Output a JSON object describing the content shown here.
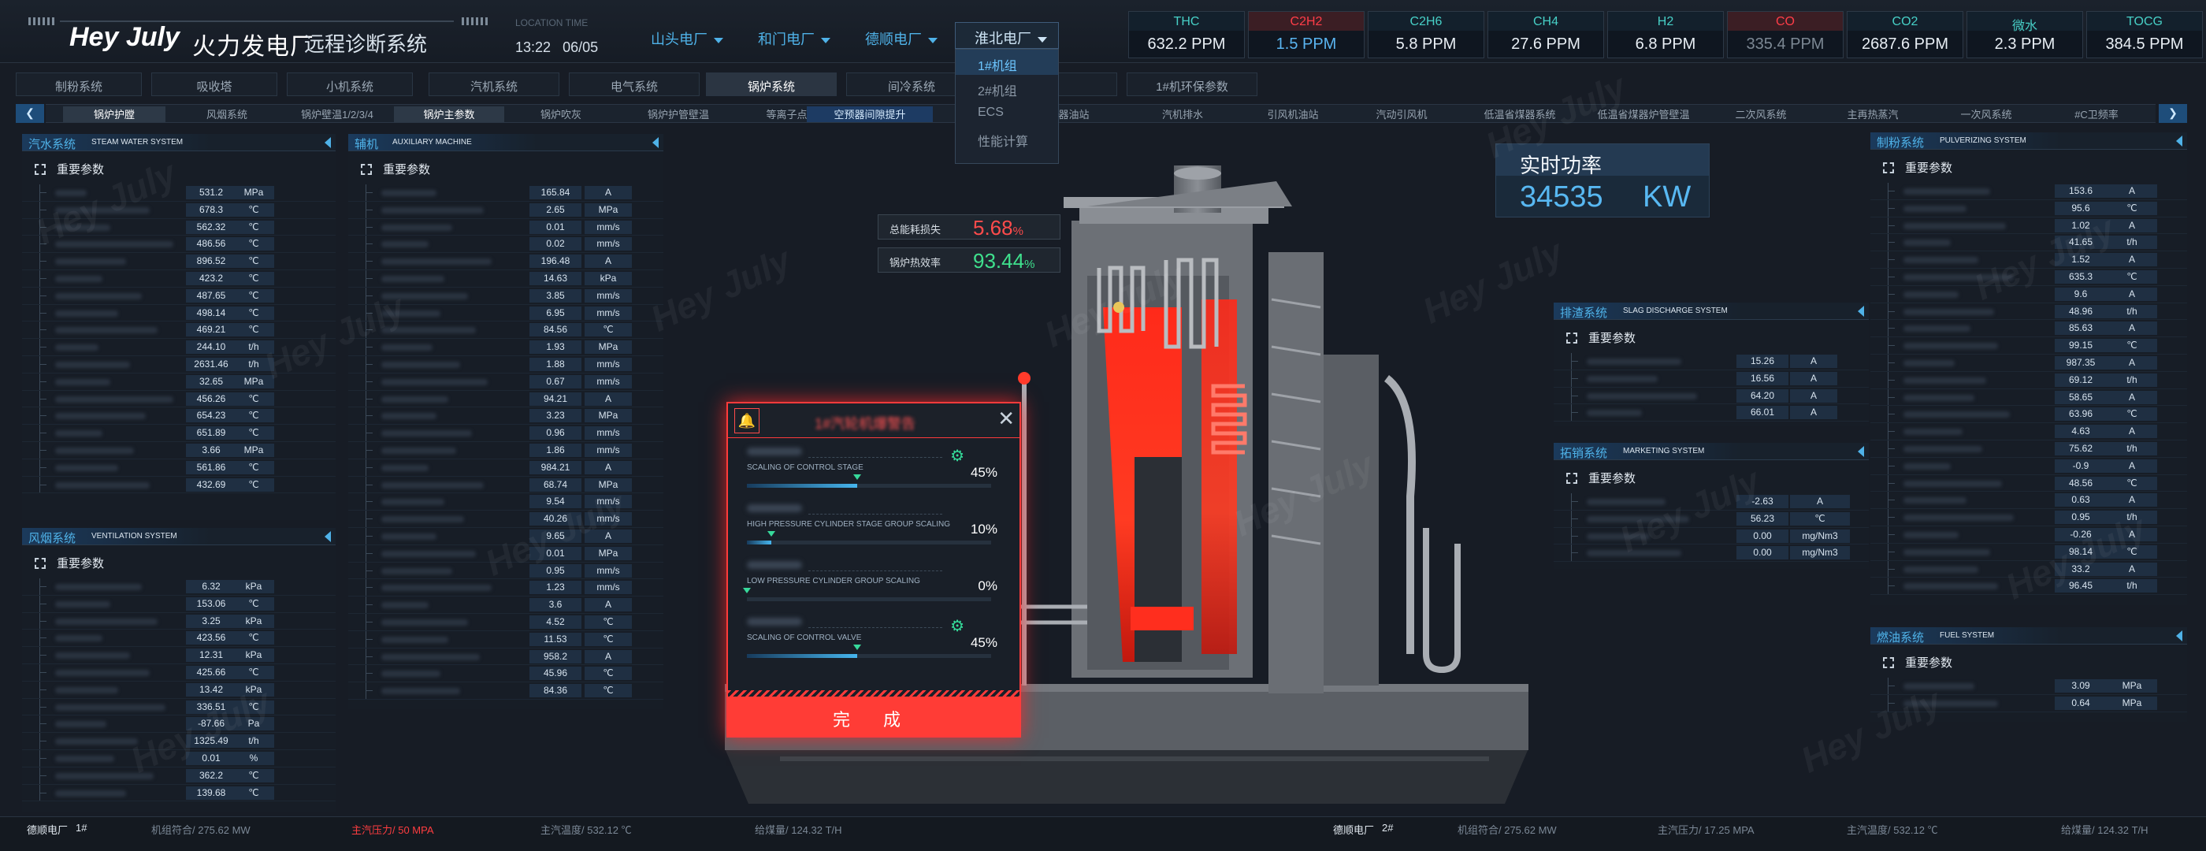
{
  "header": {
    "logo": "Hey July",
    "title": "火力发电厂",
    "subtitle": "远程诊断系统",
    "location_label": "LOCATION TIME",
    "time": "13:22",
    "date": "06/05",
    "plants": [
      "山头电厂",
      "和门电厂",
      "德顺电厂"
    ],
    "selected_plant": "淮北电厂",
    "dropdown": [
      "1#机组",
      "2#机组",
      "ECS",
      "性能计算"
    ]
  },
  "gases": [
    {
      "name": "THC",
      "value": "632.2 PPM",
      "state": "normal"
    },
    {
      "name": "C2H2",
      "value": "1.5 PPM",
      "state": "alarm"
    },
    {
      "name": "C2H6",
      "value": "5.8 PPM",
      "state": "normal"
    },
    {
      "name": "CH4",
      "value": "27.6 PPM",
      "state": "normal"
    },
    {
      "name": "H2",
      "value": "6.8 PPM",
      "state": "normal"
    },
    {
      "name": "CO",
      "value": "335.4 PPM",
      "state": "alarm-dim"
    },
    {
      "name": "CO2",
      "value": "2687.6 PPM",
      "state": "normal"
    },
    {
      "name": "微水",
      "value": "2.3 PPM",
      "state": "normal"
    },
    {
      "name": "TOCG",
      "value": "384.5 PPM",
      "state": "normal"
    }
  ],
  "menu1": [
    "制粉系统",
    "吸收塔",
    "小机系统",
    "汽机系统",
    "电气系统",
    "锅炉系统",
    "间冷系统",
    "",
    "1#机环保参数"
  ],
  "menu2": [
    "锅炉护膛",
    "风烟系统",
    "锅炉壁温1/2/3/4",
    "锅炉主参数",
    "锅炉吹灰",
    "锅炉护管壁温",
    "等离子点火",
    "空预器间隙提升",
    "",
    "器油站",
    "汽机排水",
    "引风机油站",
    "汽动引风机",
    "低温省煤器系统",
    "低温省煤器炉管壁温",
    "二次风系统",
    "主再热蒸汽",
    "一次风系统",
    "#C卫频率"
  ],
  "left_panels": {
    "steam": {
      "title": "汽水系统",
      "title_en": "STEAM WATER SYSTEM",
      "sub": "重要参数",
      "rows": [
        [
          "531.2",
          "MPa"
        ],
        [
          "678.3",
          "℃"
        ],
        [
          "562.32",
          "℃"
        ],
        [
          "486.56",
          "℃"
        ],
        [
          "896.52",
          "℃"
        ],
        [
          "423.2",
          "℃"
        ],
        [
          "487.65",
          "℃"
        ],
        [
          "498.14",
          "℃"
        ],
        [
          "469.21",
          "℃"
        ],
        [
          "244.10",
          "t/h"
        ],
        [
          "2631.46",
          "t/h"
        ],
        [
          "32.65",
          "MPa"
        ],
        [
          "456.26",
          "℃"
        ],
        [
          "654.23",
          "℃"
        ],
        [
          "651.89",
          "℃"
        ],
        [
          "3.66",
          "MPa"
        ],
        [
          "561.86",
          "℃"
        ],
        [
          "432.69",
          "℃"
        ]
      ]
    },
    "vent": {
      "title": "风烟系统",
      "title_en": "VENTILATION SYSTEM",
      "sub": "重要参数",
      "rows": [
        [
          "6.32",
          "kPa"
        ],
        [
          "153.06",
          "℃"
        ],
        [
          "3.25",
          "kPa"
        ],
        [
          "423.56",
          "℃"
        ],
        [
          "12.31",
          "kPa"
        ],
        [
          "425.66",
          "℃"
        ],
        [
          "13.42",
          "kPa"
        ],
        [
          "336.51",
          "℃"
        ],
        [
          "-87.66",
          "Pa"
        ],
        [
          "1325.49",
          "t/h"
        ],
        [
          "0.01",
          "%"
        ],
        [
          "362.2",
          "℃"
        ],
        [
          "139.68",
          "℃"
        ]
      ]
    },
    "aux": {
      "title": "辅机",
      "title_en": "AUXILIARY MACHINE",
      "sub": "重要参数",
      "rows": [
        [
          "165.84",
          "A"
        ],
        [
          "2.65",
          "MPa"
        ],
        [
          "0.01",
          "mm/s"
        ],
        [
          "0.02",
          "mm/s"
        ],
        [
          "196.48",
          "A"
        ],
        [
          "14.63",
          "kPa"
        ],
        [
          "3.85",
          "mm/s"
        ],
        [
          "6.95",
          "mm/s"
        ],
        [
          "84.56",
          "℃"
        ],
        [
          "1.93",
          "MPa"
        ],
        [
          "1.88",
          "mm/s"
        ],
        [
          "0.67",
          "mm/s"
        ],
        [
          "94.21",
          "A"
        ],
        [
          "3.23",
          "MPa"
        ],
        [
          "0.96",
          "mm/s"
        ],
        [
          "1.86",
          "mm/s"
        ],
        [
          "984.21",
          "A"
        ],
        [
          "68.74",
          "MPa"
        ],
        [
          "9.54",
          "mm/s"
        ],
        [
          "40.26",
          "mm/s"
        ],
        [
          "9.65",
          "A"
        ],
        [
          "0.01",
          "MPa"
        ],
        [
          "0.95",
          "mm/s"
        ],
        [
          "1.23",
          "mm/s"
        ],
        [
          "3.6",
          "A"
        ],
        [
          "4.52",
          "℃"
        ],
        [
          "11.53",
          "℃"
        ],
        [
          "958.2",
          "A"
        ],
        [
          "45.96",
          "℃"
        ],
        [
          "84.36",
          "℃"
        ]
      ]
    }
  },
  "right_panels": {
    "pulv": {
      "title": "制粉系统",
      "title_en": "PULVERIZING SYSTEM",
      "sub": "重要参数",
      "rows": [
        [
          "153.6",
          "A"
        ],
        [
          "95.6",
          "℃"
        ],
        [
          "1.02",
          "A"
        ],
        [
          "41.65",
          "t/h"
        ],
        [
          "1.52",
          "A"
        ],
        [
          "635.3",
          "℃"
        ],
        [
          "9.6",
          "A"
        ],
        [
          "48.96",
          "t/h"
        ],
        [
          "85.63",
          "A"
        ],
        [
          "99.15",
          "℃"
        ],
        [
          "987.35",
          "A"
        ],
        [
          "69.12",
          "t/h"
        ],
        [
          "58.65",
          "A"
        ],
        [
          "63.96",
          "℃"
        ],
        [
          "4.63",
          "A"
        ],
        [
          "75.62",
          "t/h"
        ],
        [
          "-0.9",
          "A"
        ],
        [
          "48.56",
          "℃"
        ],
        [
          "0.63",
          "A"
        ],
        [
          "0.95",
          "t/h"
        ],
        [
          "-0.26",
          "A"
        ],
        [
          "98.14",
          "℃"
        ],
        [
          "33.2",
          "A"
        ],
        [
          "96.45",
          "t/h"
        ]
      ]
    },
    "slag": {
      "title": "排渣系统",
      "title_en": "SLAG DISCHARGE SYSTEM",
      "sub": "重要参数",
      "rows": [
        [
          "15.26",
          "A"
        ],
        [
          "16.56",
          "A"
        ],
        [
          "64.20",
          "A"
        ],
        [
          "66.01",
          "A"
        ]
      ]
    },
    "market": {
      "title": "拓销系统",
      "title_en": "MARKETING SYSTEM",
      "sub": "重要参数",
      "rows": [
        [
          "-2.63",
          "A"
        ],
        [
          "56.23",
          "℃"
        ],
        [
          "0.00",
          "mg/Nm3"
        ],
        [
          "0.00",
          "mg/Nm3"
        ]
      ]
    },
    "fuel": {
      "title": "燃油系统",
      "title_en": "FUEL SYSTEM",
      "sub": "重要参数",
      "rows": [
        [
          "3.09",
          "MPa"
        ],
        [
          "0.64",
          "MPa"
        ]
      ]
    }
  },
  "metrics": {
    "loss_label": "总能耗损失",
    "loss_value": "5.68",
    "loss_unit": "%",
    "eff_label": "锅炉热效率",
    "eff_value": "93.44",
    "eff_unit": "%"
  },
  "power": {
    "title": "实时功率",
    "value": "34535",
    "unit": "KW"
  },
  "modal": {
    "title": "1#汽轮机爆警告",
    "confirm": "完  成",
    "items": [
      {
        "en": "SCALING OF CONTROL STAGE",
        "percent": "45%",
        "fraction": 0.45,
        "robot": true
      },
      {
        "en": "HIGH PRESSURE CYLINDER STAGE GROUP SCALING",
        "percent": "10%",
        "fraction": 0.1,
        "robot": false
      },
      {
        "en": "LOW PRESSURE CYLINDER GROUP SCALING",
        "percent": "0%",
        "fraction": 0.0,
        "robot": false
      },
      {
        "en": "SCALING OF CONTROL VALVE",
        "percent": "45%",
        "fraction": 0.45,
        "robot": true
      }
    ]
  },
  "footer": {
    "u1_plant": "德顺电厂",
    "u1_unit": "1#",
    "u1_load": "机组符合/ 275.62 MW",
    "u1_pressure": "主汽压力/  50 MPA",
    "u1_temp": "主汽温度/  532.12 ℃",
    "u1_coal": "给煤量/  124.32 T/H",
    "u2_plant": "德顺电厂",
    "u2_unit": "2#",
    "u2_load": "机组符合/ 275.62 MW",
    "u2_pressure": "主汽压力/  17.25 MPA",
    "u2_temp": "主汽温度/  532.12 ℃",
    "u2_coal": "给煤量/  124.32 T/H"
  },
  "watermark": "Hey July"
}
